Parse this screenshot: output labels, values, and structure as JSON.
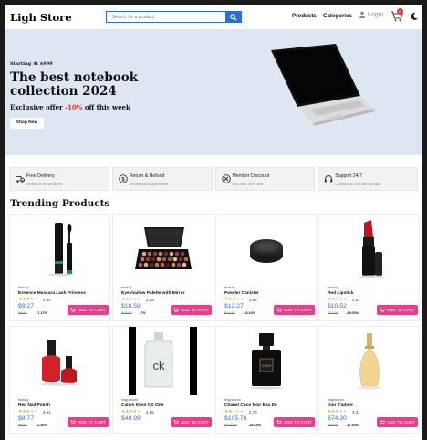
{
  "header": {
    "logo": "Ligh Store",
    "search_placeholder": "Search for a product...",
    "nav_products": "Products",
    "nav_categories": "Categories",
    "login": "Login",
    "cart_count": "0"
  },
  "hero": {
    "kicker": "Starting At $999",
    "title": "The best notebook collection 2024",
    "offer_prefix": "Exclusive offer ",
    "offer_pct": "-10%",
    "offer_suffix": " off this week",
    "button": "Shop Now"
  },
  "features": [
    {
      "title": "Free Delivery",
      "sub": "Orders from all items",
      "icon": "truck-icon"
    },
    {
      "title": "Return & Refund",
      "sub": "Money back guarantee",
      "icon": "dollar-icon"
    },
    {
      "title": "Member Discount",
      "sub": "On order over $99",
      "icon": "badge-icon"
    },
    {
      "title": "Support 24/7",
      "sub": "Contact us 24 hours a day",
      "icon": "headset-icon"
    }
  ],
  "section_title": "Trending Products",
  "add_to_cart": "ADD TO CART",
  "products": [
    {
      "category": "beauty",
      "name": "Essence Mascara Lash Princess",
      "rating": "4.94",
      "stars": 4,
      "price": "$9.27",
      "old_price": "$9.99",
      "discount": "-7.17%",
      "image": "mascara"
    },
    {
      "category": "beauty",
      "name": "Eyeshadow Palette with Mirror",
      "rating": "3.28",
      "stars": 3,
      "price": "$18.59",
      "old_price": "$19.99",
      "discount": "-7%",
      "image": "palette"
    },
    {
      "category": "beauty",
      "name": "Powder Canister",
      "rating": "3.82",
      "stars": 3,
      "price": "$12.27",
      "old_price": "$14.99",
      "discount": "-18.14%",
      "image": "powder"
    },
    {
      "category": "beauty",
      "name": "Red Lipstick",
      "rating": "2.51",
      "stars": 2,
      "price": "$10.52",
      "old_price": "$12.99",
      "discount": "-19.03%",
      "image": "lipstick"
    },
    {
      "category": "beauty",
      "name": "Red Nail Polish",
      "rating": "3.91",
      "stars": 3,
      "price": "$8.77",
      "old_price": "$8.99",
      "discount": "-2.46%",
      "image": "nailpolish"
    },
    {
      "category": "fragrances",
      "name": "Calvin Klein CK One",
      "rating": "4.85",
      "stars": 4,
      "price": "$49.99",
      "old_price": "",
      "discount": "",
      "image": "ckone"
    },
    {
      "category": "fragrances",
      "name": "Chanel Coco Noir Eau De",
      "rating": "2.76",
      "stars": 2,
      "price": "$105.76",
      "old_price": "$129.99",
      "discount": "-18.64%",
      "image": "coconoir"
    },
    {
      "category": "fragrances",
      "name": "Dior J'adore",
      "rating": "3.31",
      "stars": 3,
      "price": "$74.30",
      "old_price": "$89.99",
      "discount": "-17.44%",
      "image": "jadore"
    }
  ],
  "colors": {
    "accent": "#2b6fd6",
    "cart_button": "#e83e8c",
    "hero_bg": "#dde6f1",
    "discount": "#e53935"
  }
}
